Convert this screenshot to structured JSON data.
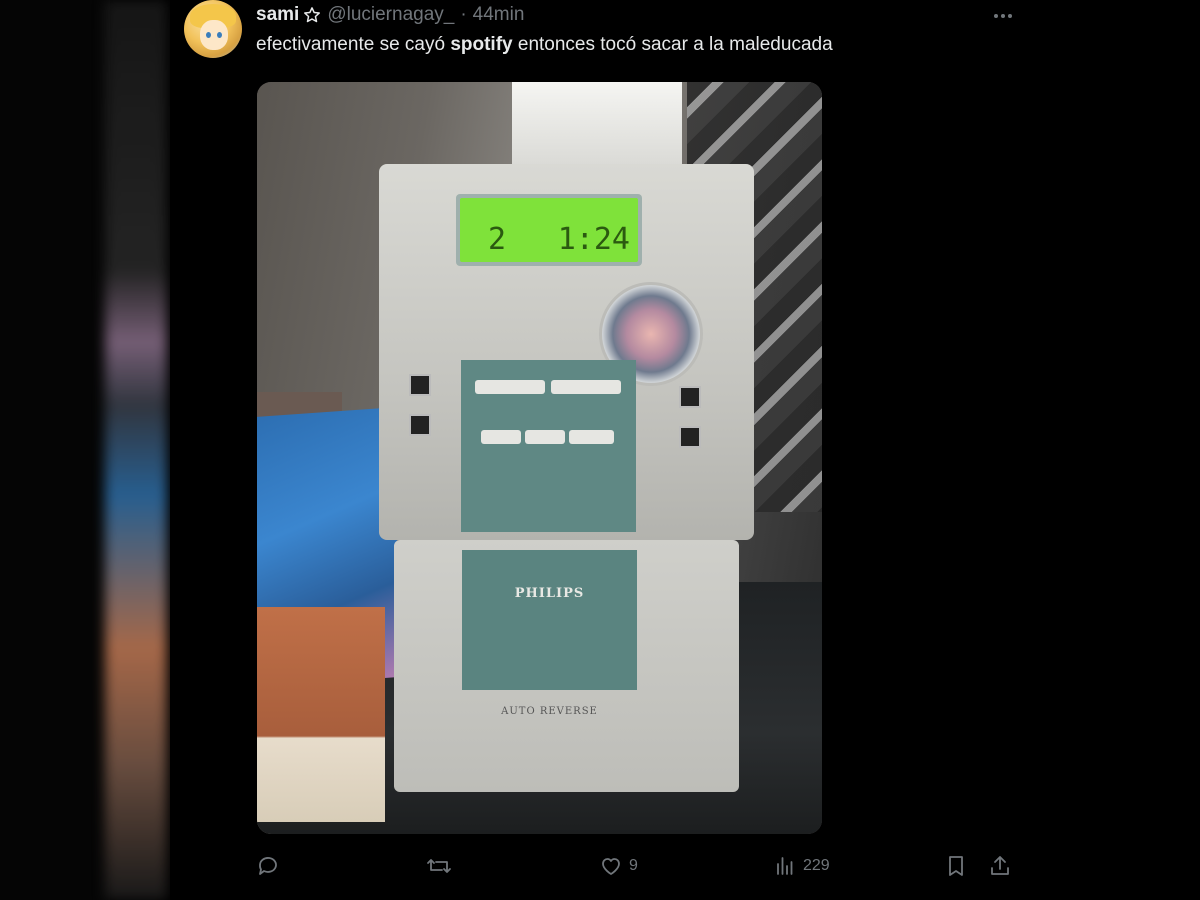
{
  "tweet": {
    "author_name": "sami",
    "author_badge_icon": "star-icon",
    "author_handle": "@luciernagay_",
    "separator": "·",
    "time": "44min",
    "text_before": "efectivamente se cayó ",
    "text_bold": "spotify",
    "text_after": " entonces tocó sacar a la maleducada"
  },
  "media": {
    "lcd_track": "2",
    "lcd_time": "1:24",
    "brand": "PHILIPS",
    "cassette_label": "AUTO REVERSE"
  },
  "actions": {
    "reply_count": "",
    "retweet_count": "",
    "like_count": "9",
    "views_count": "229"
  },
  "colors": {
    "background": "#000000",
    "primary_text": "#e7e9ea",
    "secondary_text": "#71767b",
    "lcd_green": "#7fe23a"
  }
}
